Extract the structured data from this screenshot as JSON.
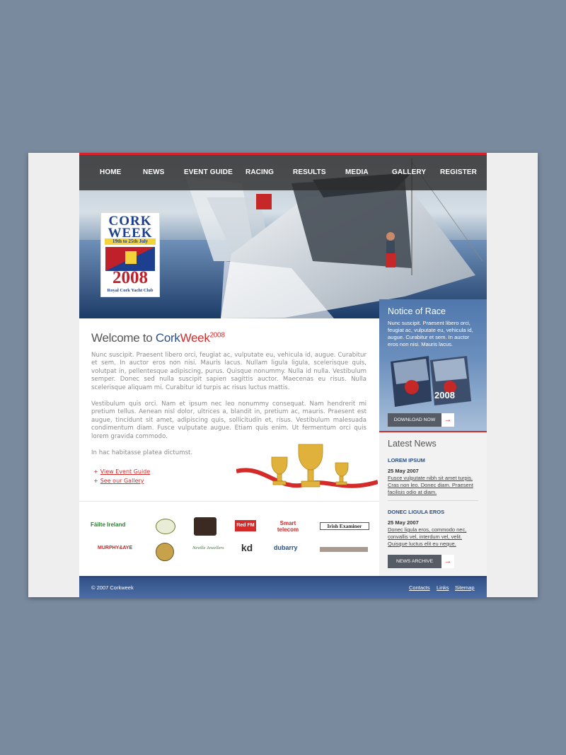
{
  "nav": {
    "items": [
      "HOME",
      "NEWS",
      "EVENT GUIDE",
      "RACING",
      "RESULTS",
      "MEDIA",
      "GALLERY",
      "REGISTER"
    ]
  },
  "logo": {
    "line1": "CORK",
    "line2": "WEEK",
    "dates": "19th to 25th July",
    "year": "2008",
    "club": "Royal Cork Yacht Club"
  },
  "welcome": {
    "prefix": "Welcome to ",
    "cork": "Cork",
    "week": "Week",
    "year": "2008"
  },
  "main": {
    "paragraphs": [
      "Nunc suscipit. Praesent libero orci, feugiat ac, vulputate eu, vehicula id, augue. Curabitur et sem. In auctor eros non nisi. Mauris lacus. Nullam ligula ligula, scelerisque quis, volutpat in, pellentesque adipiscing, purus. Quisque nonummy. Nulla id nulla. Vestibulum semper. Donec sed nulla suscipit sapien sagittis auctor. Maecenas eu risus. Nulla scelerisque aliquam mi. Curabitur id turpis ac risus luctus mattis.",
      "Vestibulum quis orci. Nam et ipsum nec leo nonummy consequat. Nam hendrerit mi pretium tellus. Aenean nisl dolor, ultrices a, blandit in, pretium ac, mauris. Praesent est augue, tincidunt sit amet, adipiscing quis, sollicitudin et, risus. Vestibulum malesuada condimentum diam. Fusce vulputate augue. Etiam quis enim. Ut fermentum orci quis lorem gravida commodo.",
      "In hac habitasse platea dictumst."
    ],
    "links": [
      "View Event Guide",
      "See our Gallery"
    ]
  },
  "sponsors": {
    "row1": [
      "Fáilte Ireland",
      "",
      "",
      "Red FM",
      "Smart telecom",
      "Irish Examiner"
    ],
    "row2": [
      "MURPHY&AYE",
      "",
      "Neville Jewellers",
      "kd",
      "dubarry",
      ""
    ]
  },
  "notice": {
    "title": "Notice of Race",
    "text": "Nunc suscipit. Praesent libero orci, feugiat ac, vulputate eu, vehicula id, augue. Curabitur et sem. In auctor eros non nisi. Mauris lacus.",
    "button": "DOWNLOAD NOW",
    "arrow": "→",
    "brochure_year": "2008"
  },
  "news": {
    "title": "Latest News",
    "items": [
      {
        "heading": "LOREM IPSUM",
        "date": "25 May 2007",
        "text": "Fusce vulputate nibh sit amet turpis. Cras non leo. Donec diam. Praesent facilisis odio at diam."
      },
      {
        "heading": "DONEC LIGULA EROS",
        "date": "25 May 2007",
        "text": "Donec ligula eros, commodo nec, convallis vel, interdum vel, velit. Quisque luctus elit eu neque."
      }
    ],
    "archive_button": "NEWS ARCHIVE",
    "arrow": "→"
  },
  "footer": {
    "copyright": "© 2007 Corkweek",
    "links": [
      "Contacts",
      "Links",
      "Sitemap"
    ]
  },
  "colors": {
    "background": "#7a8a9e",
    "accent_red": "#d32a2a",
    "brand_blue": "#2b4f85",
    "nav_bar": "#2d2d2d"
  },
  "icons": [
    "arrow-right-icon",
    "plus-icon",
    "trophy-icon",
    "yacht-image",
    "brochure-image"
  ]
}
